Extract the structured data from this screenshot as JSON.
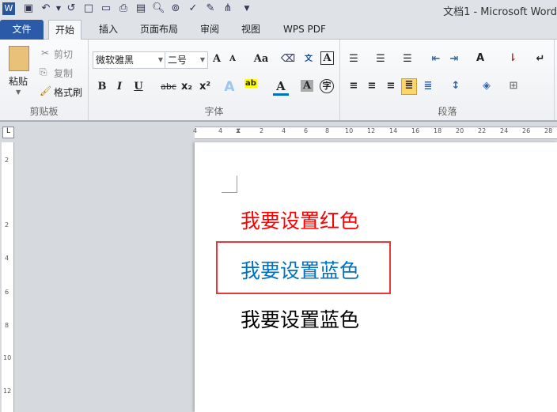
{
  "window": {
    "title": "文档1 - Microsoft Word"
  },
  "tabs": [
    {
      "label": "文件"
    },
    {
      "label": "开始"
    },
    {
      "label": "插入"
    },
    {
      "label": "页面布局"
    },
    {
      "label": "审阅"
    },
    {
      "label": "视图"
    },
    {
      "label": "WPS PDF"
    }
  ],
  "clipboard": {
    "paste": "粘贴",
    "cut": "剪切",
    "copy": "复制",
    "format_painter": "格式刷",
    "label": "剪贴板"
  },
  "font": {
    "name": "微软雅黑",
    "size": "二号",
    "label": "字体",
    "bold": "B",
    "italic": "I",
    "underline": "U",
    "strike": "abc",
    "sub": "x₂",
    "sup": "x²",
    "grow": "A",
    "shrink": "A",
    "case": "Aa",
    "color": "A",
    "shade": "A",
    "enclose": "字"
  },
  "paragraph": {
    "label": "段落"
  },
  "ruler": {
    "h": [
      "4",
      "2",
      "2",
      "4",
      "6",
      "8",
      "10",
      "12",
      "14",
      "16",
      "18",
      "20",
      "22",
      "24",
      "26",
      "28"
    ],
    "v": [
      "2",
      "2",
      "4",
      "6",
      "8",
      "10",
      "12"
    ]
  },
  "document": {
    "lines": [
      {
        "text": "我要设置红色",
        "color": "#ff0000"
      },
      {
        "text": "我要设置蓝色",
        "color": "#0070c0"
      },
      {
        "text": "我要设置蓝色",
        "color": "#000000"
      }
    ]
  }
}
